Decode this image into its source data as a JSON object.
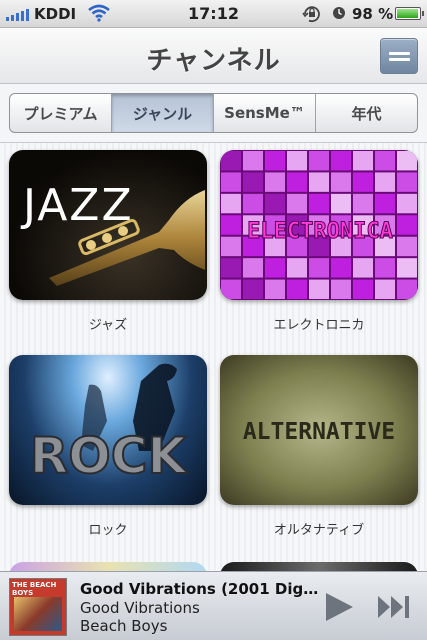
{
  "status_bar": {
    "carrier": "KDDI",
    "time": "17:12",
    "battery_percent_text": "98 %",
    "battery_level": 0.98,
    "icons": [
      "signal-icon",
      "wifi-icon",
      "rotation-lock-icon",
      "alarm-icon",
      "battery-icon"
    ]
  },
  "nav": {
    "title": "チャンネル",
    "menu_icon": "list-icon"
  },
  "segments": [
    {
      "label": "プレミアム",
      "selected": false
    },
    {
      "label": "ジャンル",
      "selected": true
    },
    {
      "label": "SensMe™",
      "selected": false
    },
    {
      "label": "年代",
      "selected": false
    }
  ],
  "channels": [
    {
      "label": "ジャズ",
      "art_text": "JAZZ"
    },
    {
      "label": "エレクトロニカ",
      "art_text": "ELECTRONICA"
    },
    {
      "label": "ロック",
      "art_text": "ROCK"
    },
    {
      "label": "オルタナティブ",
      "art_text": "ALTERNATIVE"
    }
  ],
  "now_playing": {
    "title": "Good Vibrations (2001 Digit...",
    "album": "Good Vibrations",
    "artist": "Beach Boys",
    "cover_text": "THE BEACH BOYS",
    "controls": [
      "play-icon",
      "next-track-icon"
    ]
  },
  "colors": {
    "accent_blue": "#6f86a1",
    "segment_selected": "#c0ccdc",
    "battery_green": "#2da41a"
  }
}
